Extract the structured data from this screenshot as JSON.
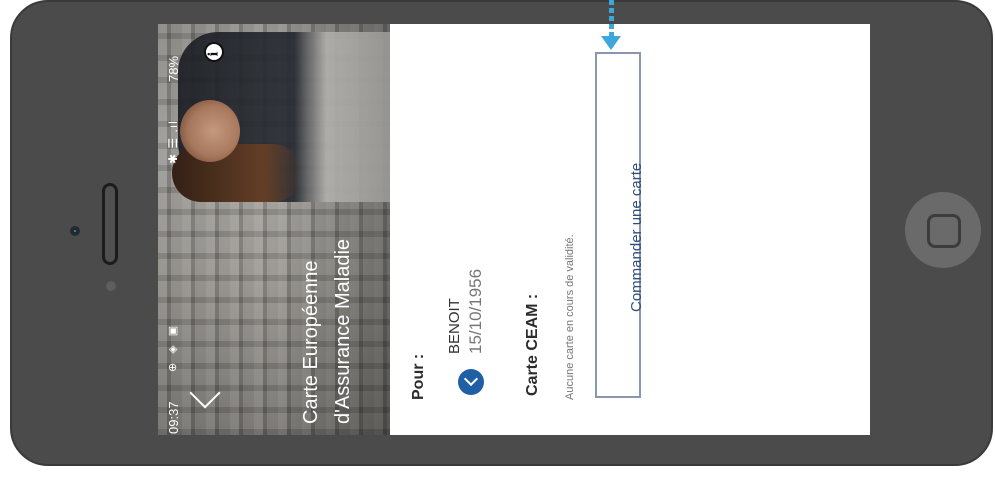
{
  "status_bar": {
    "time": "09:37",
    "left_icons": "⊕ ◈ ▣",
    "right_icons": "✱ ☰ .ıl",
    "battery": "78%"
  },
  "hero": {
    "title_line1": "Carte Européenne",
    "title_line2": "d'Assurance Maladie",
    "info_icon": "i"
  },
  "content": {
    "pour_label": "Pour :",
    "user_name": "BENOIT",
    "user_dob": "15/10/1956",
    "ceam_label": "Carte CEAM :",
    "no_card_text": "Aucune carte en cours de validité.",
    "order_button_label": "Commander une carte"
  },
  "colors": {
    "accent_blue": "#1f5fa6",
    "button_border": "#8a96ad",
    "arrow": "#3ba7db",
    "phone_body": "#4b4b4b"
  }
}
